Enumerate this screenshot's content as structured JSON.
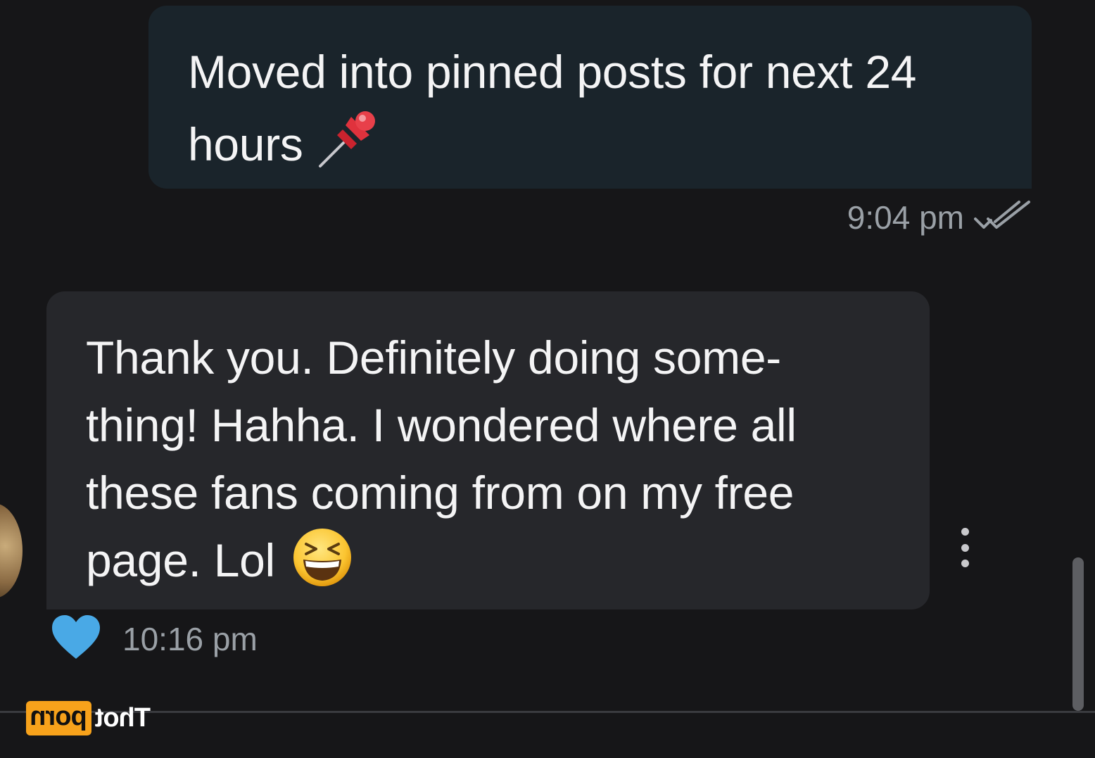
{
  "conversation": {
    "outgoing": {
      "text": "Moved into pinned posts for next 24 hours",
      "emoji_icon": "pushpin-icon",
      "time": "9:04 pm",
      "status_icon": "double-check-icon"
    },
    "incoming": {
      "text": "Thank you. Definitely doing some- thing! Hahha. I wondered where all these fans coming from on my free page. Lol",
      "emoji_icon": "grinning-squinting-face-icon",
      "time": "10:16 pm",
      "reaction_icon": "blue-heart-icon"
    }
  },
  "watermark": {
    "part1": "Thot",
    "part2": "porn"
  },
  "colors": {
    "background": "#161618",
    "outgoing_bubble": "#1a242b",
    "incoming_bubble": "#26272b",
    "heart": "#49a9e6",
    "watermark_accent": "#f7a21b"
  }
}
